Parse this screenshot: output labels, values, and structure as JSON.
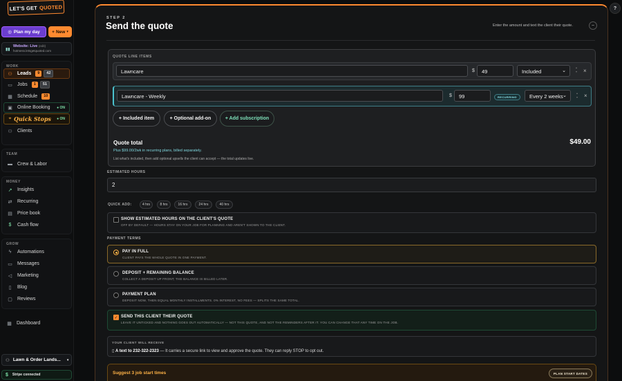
{
  "brand": {
    "logo_main": "LET'S GET",
    "logo_accent": "QUOTED"
  },
  "sidebar": {
    "plan_label": "Plan my day",
    "new_label": "New",
    "website_status": "Website: Live",
    "website_edit": "(edit)",
    "website_url": "hotmess.letsgetquoted.com",
    "groups": {
      "work": {
        "title": "WORK",
        "items": [
          {
            "label": "Leads",
            "badge1": "9",
            "badge2": "42",
            "icon": "leads-icon"
          },
          {
            "label": "Jobs",
            "badge1": "1",
            "badge2": "51",
            "icon": "jobs-icon"
          },
          {
            "label": "Schedule",
            "badge1": "10",
            "icon": "calendar-icon"
          },
          {
            "label": "Online Booking",
            "status": "ON",
            "icon": "booking-icon"
          },
          {
            "label": "Quick Stops",
            "status": "ON",
            "icon": "pin-icon"
          },
          {
            "label": "Clients",
            "icon": "clients-icon"
          }
        ]
      },
      "team": {
        "title": "TEAM",
        "items": [
          {
            "label": "Crew & Labor",
            "icon": "crew-icon"
          }
        ]
      },
      "money": {
        "title": "MONEY",
        "items": [
          {
            "label": "Insights",
            "icon": "insights-icon"
          },
          {
            "label": "Recurring",
            "icon": "recurring-icon"
          },
          {
            "label": "Price book",
            "icon": "book-icon"
          },
          {
            "label": "Cash flow",
            "icon": "cash-icon"
          }
        ]
      },
      "grow": {
        "title": "GROW",
        "items": [
          {
            "label": "Automations",
            "icon": "bolt-icon"
          },
          {
            "label": "Messages",
            "icon": "message-icon"
          },
          {
            "label": "Marketing",
            "icon": "megaphone-icon"
          },
          {
            "label": "Blog",
            "icon": "blog-icon"
          },
          {
            "label": "Reviews",
            "icon": "reviews-icon"
          }
        ]
      }
    },
    "dashboard": "Dashboard",
    "account": "Lawn & Order Lands...",
    "stripe": "Stripe connected"
  },
  "main": {
    "step": "STEP 2",
    "title": "Send the quote",
    "subtitle": "Enter the amount and text the client their quote.",
    "line_items_label": "QUOTE LINE ITEMS",
    "items": [
      {
        "name": "Lawncare",
        "currency": "$",
        "price": "49",
        "type": "Included"
      },
      {
        "name": "Lawncare - Weekly",
        "currency": "$",
        "price": "99",
        "tag": "RECURRING",
        "type": "Every 2 weeks"
      }
    ],
    "add_included": "+ Included item",
    "add_optional": "+ Optional add-on",
    "add_subscription": "+ Add subscription",
    "quote_total_label": "Quote total",
    "quote_total_value": "$49.00",
    "quote_plus": "Plus $99.00/2wk in recurring plans, billed separately.",
    "quote_hint": "List what's included, then add optional upsells the client can accept — the total updates live.",
    "estimated_hours_label": "ESTIMATED HOURS",
    "estimated_hours_value": "2",
    "quick_add_label": "QUICK ADD:",
    "quick_add": [
      "4 hrs",
      "8 hrs",
      "16 hrs",
      "24 hrs",
      "40 hrs"
    ],
    "show_hours_title": "SHOW ESTIMATED HOURS ON THE CLIENT'S QUOTE",
    "show_hours_sub": "OFF BY DEFAULT — HOURS STAY ON YOUR JOB FOR PLANNING AND AREN'T SHOWN TO THE CLIENT.",
    "payment_terms_label": "PAYMENT TERMS",
    "payment_options": [
      {
        "title": "PAY IN FULL",
        "sub": "CLIENT PAYS THE WHOLE QUOTE IN ONE PAYMENT."
      },
      {
        "title": "DEPOSIT + REMAINING BALANCE",
        "sub": "COLLECT A DEPOSIT UP FRONT; THE BALANCE IS BILLED LATER."
      },
      {
        "title": "PAYMENT PLAN",
        "sub": "DEPOSIT NOW, THEN EQUAL MONTHLY INSTALLMENTS. 0% INTEREST, NO FEES — SPLITS THE SAME TOTAL."
      }
    ],
    "send_title": "SEND THIS CLIENT THEIR QUOTE",
    "send_sub": "LEAVE IT UNTICKED AND NOTHING GOES OUT AUTOMATICALLY — NOT THIS QUOTE, AND NOT THE REMINDERS AFTER IT. YOU CAN CHANGE THAT ANY TIME ON THE JOB.",
    "receive_label": "YOUR CLIENT WILL RECEIVE",
    "receive_bold": "A text to 232-322-2323",
    "receive_rest": " — It carries a secure link to view and approve the quote. They can reply STOP to opt out.",
    "suggest_label": "Suggest 3 job start times",
    "plan_dates": "PLAN START DATES"
  },
  "colors": {
    "accent": "#ff8a30",
    "recurring": "#4bc3cf",
    "success": "#7ee2a8"
  }
}
